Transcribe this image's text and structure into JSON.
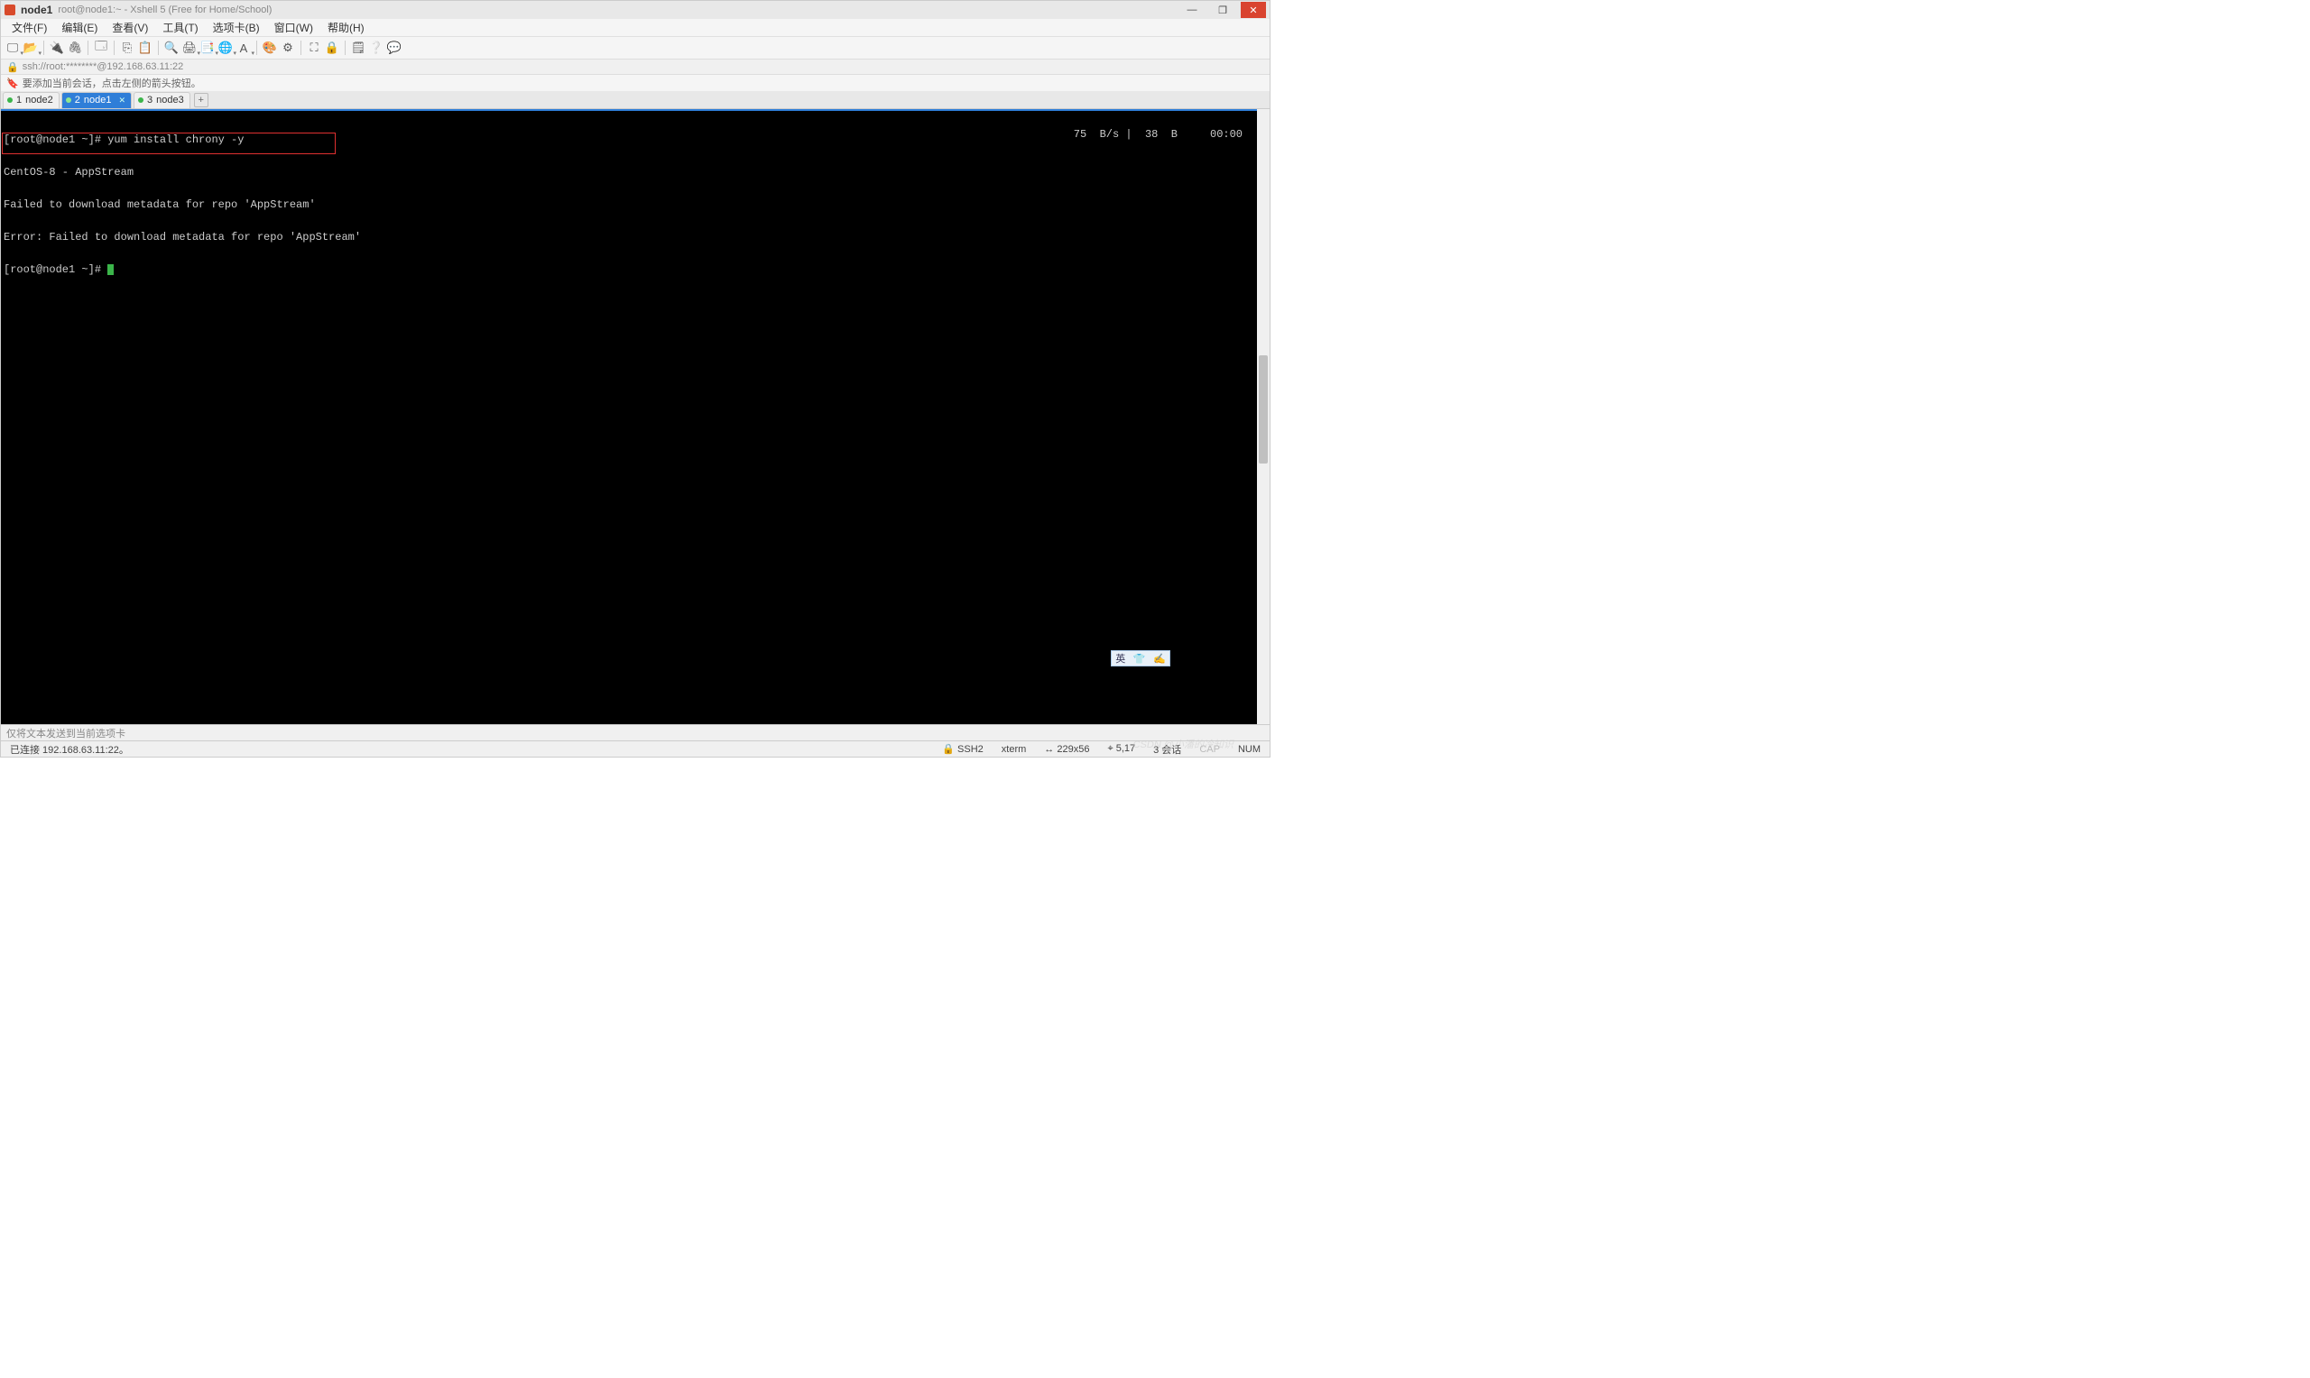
{
  "title": {
    "session": "node1",
    "rest": "root@node1:~ - Xshell 5 (Free for Home/School)"
  },
  "menu": {
    "file": "文件(F)",
    "edit": "编辑(E)",
    "view": "查看(V)",
    "tools": "工具(T)",
    "tabs": "选项卡(B)",
    "window": "窗口(W)",
    "help": "帮助(H)"
  },
  "addrbar": {
    "text": "ssh://root:********@192.168.63.11:22"
  },
  "hintbar": {
    "text": "要添加当前会话，点击左侧的箭头按钮。"
  },
  "tabs": [
    {
      "num": "1",
      "label": "node2",
      "active": false
    },
    {
      "num": "2",
      "label": "node1",
      "active": true
    },
    {
      "num": "3",
      "label": "node3",
      "active": false
    }
  ],
  "terminal": {
    "lines": [
      "[root@node1 ~]# yum install chrony -y",
      "CentOS-8 - AppStream",
      "Failed to download metadata for repo 'AppStream'",
      "Error: Failed to download metadata for repo 'AppStream'",
      "[root@node1 ~]# "
    ],
    "stats": "75  B/s |  38  B     00:00"
  },
  "ime": {
    "lang": "英",
    "icon1": "👕",
    "icon2": "✍"
  },
  "inputbar": {
    "text": "仅将文本发送到当前选项卡"
  },
  "statusbar": {
    "left": "已连接 192.168.63.11:22。",
    "ssh": "SSH2",
    "term": "xterm",
    "size": "229x56",
    "cursor": "5,17",
    "sessions": "3 会话",
    "caps": "CAP",
    "num": "NUM"
  },
  "watermark": "CSDN @小潘的冷知识"
}
